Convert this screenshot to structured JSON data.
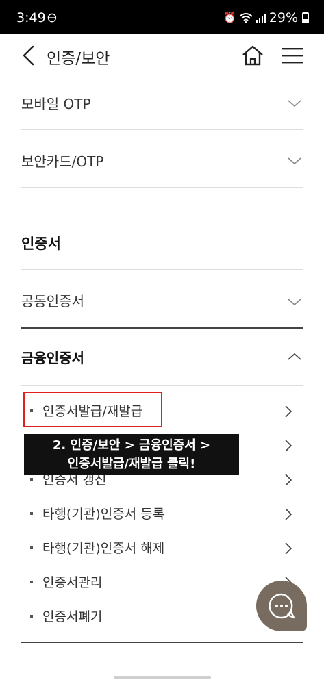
{
  "status_bar": {
    "time": "3:49",
    "dnd_glyph": "⊖",
    "battery_percent": "29%"
  },
  "header": {
    "title": "인증/보안"
  },
  "rows": {
    "mobile_otp": "모바일 OTP",
    "security_card": "보안카드/OTP",
    "section_title": "인증서",
    "joint_cert": "공동인증서",
    "financial_cert": "금융인증서"
  },
  "financial_sub_items": [
    "인증서발급/재발급",
    "",
    "인증서 갱신",
    "타행(기관)인증서 등록",
    "타행(기관)인증서 해제",
    "인증서관리",
    "인증서폐기"
  ],
  "annotation": {
    "line1": "2. 인증/보안 > 금융인증서 >",
    "line2": "인증서발급/재발급 클릭!"
  },
  "colors": {
    "highlight": "#e02020",
    "annotation_bg": "#111111",
    "chat_fab": "#776c5f"
  }
}
